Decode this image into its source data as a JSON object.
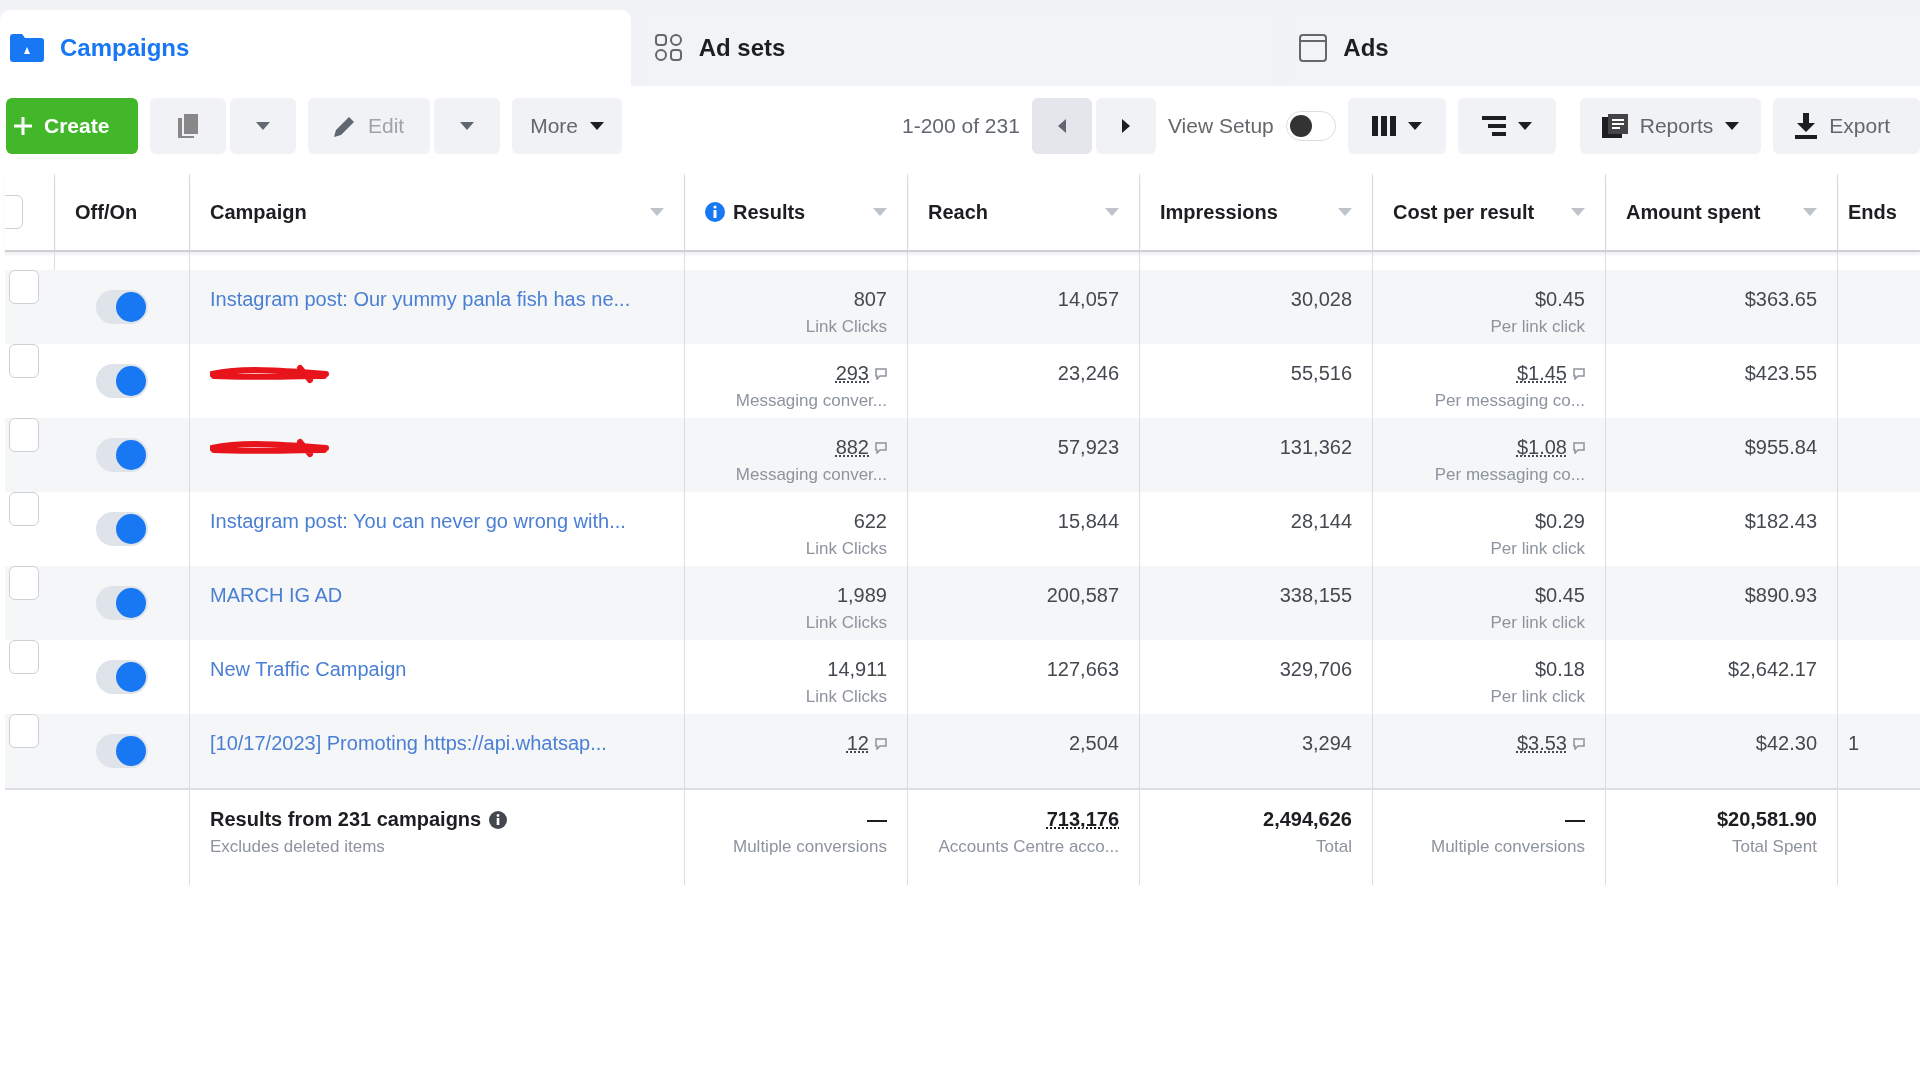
{
  "tabs": [
    {
      "label": "Campaigns",
      "kind": "campaigns",
      "selected": true
    },
    {
      "label": "Ad sets",
      "kind": "adsets",
      "selected": false
    },
    {
      "label": "Ads",
      "kind": "ads",
      "selected": false
    }
  ],
  "toolbar": {
    "create": "Create",
    "edit": "Edit",
    "more": "More",
    "pagination": "1-200 of 231",
    "view_setup": {
      "label": "View Setup",
      "on": false
    },
    "reports": "Reports",
    "export": "Export"
  },
  "table": {
    "columns": [
      "Off/On",
      "Campaign",
      "Results",
      "Reach",
      "Impressions",
      "Cost per result",
      "Amount spent",
      "Ends"
    ],
    "header_checked": false,
    "rows": [
      {
        "checked": false,
        "on": true,
        "redacted": false,
        "campaign": "Instagram post: Our yummy panla fish has ne...",
        "results": {
          "value": "807",
          "label": "Link Clicks",
          "linked": false
        },
        "reach": "14,057",
        "impressions": "30,028",
        "cost": {
          "value": "$0.45",
          "label": "Per link click",
          "linked": false
        },
        "spent": "$363.65"
      },
      {
        "checked": false,
        "on": true,
        "redacted": true,
        "results": {
          "value": "293",
          "label": "Messaging conver...",
          "linked": true
        },
        "reach": "23,246",
        "impressions": "55,516",
        "cost": {
          "value": "$1.45",
          "label": "Per messaging co...",
          "linked": true
        },
        "spent": "$423.55"
      },
      {
        "checked": false,
        "on": true,
        "redacted": true,
        "results": {
          "value": "882",
          "label": "Messaging conver...",
          "linked": true
        },
        "reach": "57,923",
        "impressions": "131,362",
        "cost": {
          "value": "$1.08",
          "label": "Per messaging co...",
          "linked": true
        },
        "spent": "$955.84"
      },
      {
        "checked": false,
        "on": true,
        "redacted": false,
        "campaign": "Instagram post: You can never go wrong with...",
        "results": {
          "value": "622",
          "label": "Link Clicks",
          "linked": false
        },
        "reach": "15,844",
        "impressions": "28,144",
        "cost": {
          "value": "$0.29",
          "label": "Per link click",
          "linked": false
        },
        "spent": "$182.43"
      },
      {
        "checked": false,
        "on": true,
        "redacted": false,
        "campaign": "MARCH IG AD",
        "results": {
          "value": "1,989",
          "label": "Link Clicks",
          "linked": false
        },
        "reach": "200,587",
        "impressions": "338,155",
        "cost": {
          "value": "$0.45",
          "label": "Per link click",
          "linked": false
        },
        "spent": "$890.93"
      },
      {
        "checked": false,
        "on": true,
        "redacted": false,
        "campaign": "New Traffic Campaign",
        "results": {
          "value": "14,911",
          "label": "Link Clicks",
          "linked": false
        },
        "reach": "127,663",
        "impressions": "329,706",
        "cost": {
          "value": "$0.18",
          "label": "Per link click",
          "linked": false
        },
        "spent": "$2,642.17"
      },
      {
        "checked": false,
        "on": true,
        "redacted": false,
        "campaign": "[10/17/2023] Promoting https://api.whatsap...",
        "results": {
          "value": "12",
          "linked": true
        },
        "reach": "2,504",
        "impressions": "3,294",
        "cost": {
          "value": "$3.53",
          "linked": true
        },
        "spent": "$42.30",
        "ends": "1"
      }
    ],
    "footer": {
      "title": "Results from 231 campaigns",
      "note": "Excludes deleted items",
      "cells": [
        {
          "value": "—",
          "label": "Multiple conversions",
          "underlined": false
        },
        {
          "value": "713,176",
          "label": "Accounts Centre acco...",
          "underlined": true
        },
        {
          "value": "2,494,626",
          "label": "Total",
          "underlined": false
        },
        {
          "value": "—",
          "label": "Multiple conversions",
          "underlined": false
        },
        {
          "value": "$20,581.90",
          "label": "Total Spent",
          "underlined": false
        }
      ]
    }
  }
}
